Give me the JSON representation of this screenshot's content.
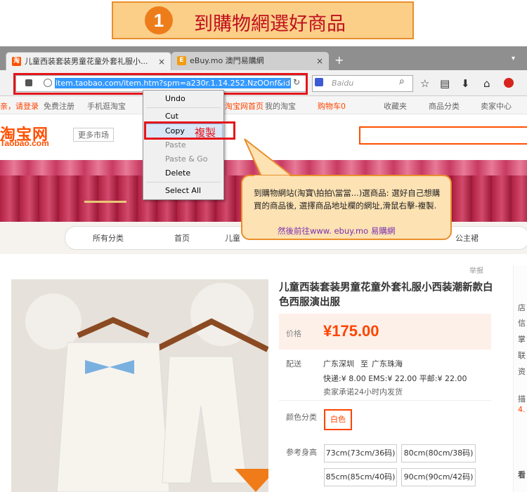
{
  "banner": {
    "step": "1",
    "title": "到購物網選好商品"
  },
  "browser": {
    "tabs": [
      {
        "label": "儿童西装套装男童花童外套礼服小...",
        "favicon": "淘",
        "close": "×"
      },
      {
        "label": "eBuy.mo 澳門易購網",
        "favicon": "E",
        "close": "×"
      }
    ],
    "new_tab": "+",
    "tab_menu": "▾",
    "url": "item.taobao.com/item.htm?spm=a230r.1.14.252.NzOOnf&id",
    "search_placeholder": "Baidu"
  },
  "context_menu": {
    "items": [
      "Undo",
      "Cut",
      "Copy",
      "Paste",
      "Paste & Go",
      "Delete",
      "Select All"
    ],
    "copy_annotation": "複製"
  },
  "callout": {
    "text": "到購物網站(淘寶\\拍拍\\當當...)選商品: 選好自己想購買的商品後, 選擇商品地址欄的網址,滑鼠右擊-複製.",
    "link": "然後前往www. ebuy.mo 易購網"
  },
  "taobao": {
    "topbar": [
      "亲，请登录",
      "免费注册",
      "手机逛淘宝",
      "淘宝网首页",
      "我的淘宝",
      "购物车0",
      "收藏夹",
      "商品分类",
      "卖家中心"
    ],
    "logo_cn": "淘宝网",
    "logo_en": "Taobao.com",
    "market": "更多市场",
    "menu": [
      "所有分类",
      "首页",
      "儿童",
      "公主裙"
    ],
    "report": "举报",
    "product_title": "儿童西装套装男童花童外套礼服小西装潮新款白色西服演出服",
    "price_label": "价格",
    "price": "¥175.00",
    "ship_label": "配送",
    "ship_from": "广东深圳",
    "ship_to_word": "至",
    "ship_to": "广东珠海",
    "ship_fees": "快递:¥ 8.00  EMS:¥ 22.00  平邮:¥ 22.00",
    "ship_note": "卖家承诺24小时内发货",
    "color_label": "颜色分类",
    "color_value": "白色",
    "size_label": "参考身高",
    "sizes": [
      "73cm(73cm/36码)",
      "80cm(80cm/38码)",
      "85cm(85cm/40码)",
      "90cm(90cm/42码)"
    ],
    "side": [
      "店",
      "信",
      "掌",
      "联",
      "资",
      "描",
      "4.",
      "看"
    ]
  },
  "colors": {
    "accent": "#ff5000",
    "annotation_red": "#e5151b",
    "banner_bg": "#fbcf88"
  }
}
